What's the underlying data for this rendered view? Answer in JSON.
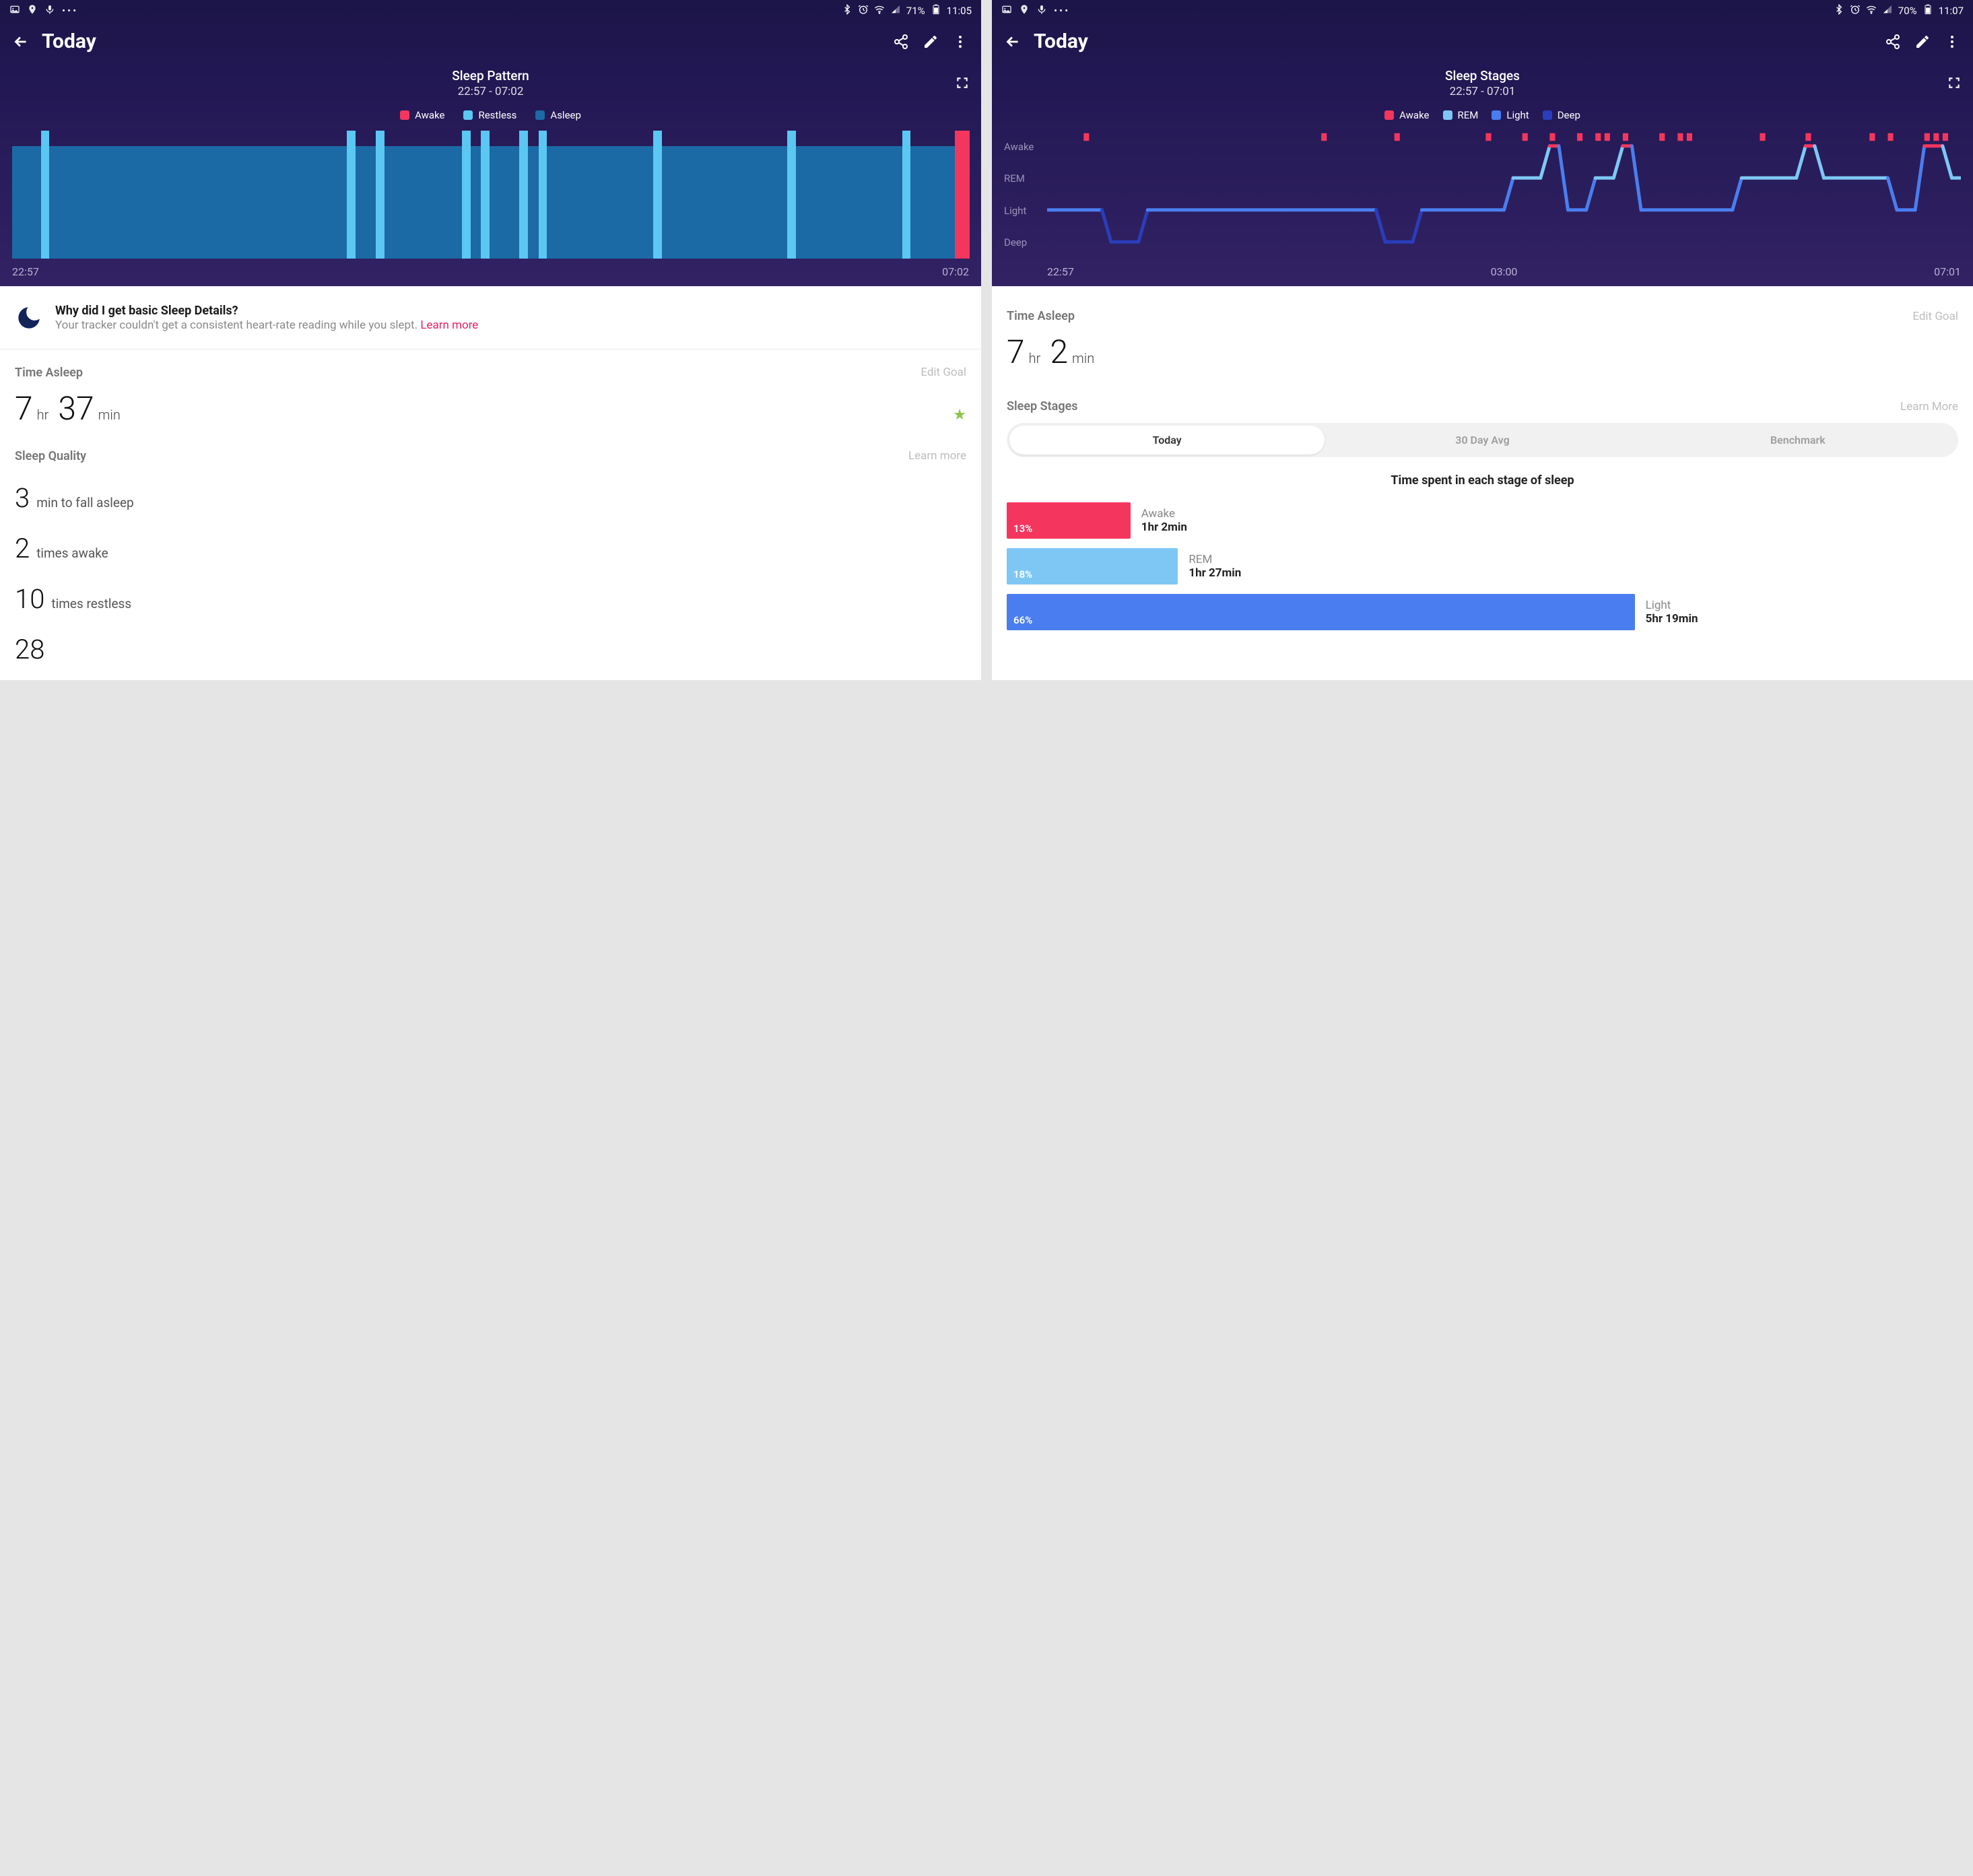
{
  "colors": {
    "awake": "#f4365e",
    "restless": "#5bc7f3",
    "asleep": "#1b6aa5",
    "rem": "#7ec7f5",
    "light": "#4a7ef0",
    "deep": "#2a3dbb",
    "star": "#8bc34a",
    "moon": "#12245a"
  },
  "left": {
    "status": {
      "battery": "71%",
      "time": "11:05"
    },
    "title": "Today",
    "chart": {
      "title": "Sleep Pattern",
      "subtitle": "22:57 - 07:02",
      "legend": [
        "Awake",
        "Restless",
        "Asleep"
      ],
      "xstart": "22:57",
      "xend": "07:02"
    },
    "notice": {
      "title": "Why did I get basic Sleep Details?",
      "body": "Your tracker couldn't get a consistent heart-rate reading while you slept. ",
      "link": "Learn more"
    },
    "time_asleep": {
      "label": "Time Asleep",
      "edit": "Edit Goal",
      "hr": "7",
      "hr_unit": "hr",
      "min": "37",
      "min_unit": "min"
    },
    "quality": {
      "label": "Sleep Quality",
      "link": "Learn more",
      "items": [
        {
          "num": "3",
          "text": "min to fall asleep"
        },
        {
          "num": "2",
          "text": "times awake"
        },
        {
          "num": "10",
          "text": "times restless"
        },
        {
          "num": "28",
          "text": ""
        }
      ]
    }
  },
  "right": {
    "status": {
      "battery": "70%",
      "time": "11:07"
    },
    "title": "Today",
    "chart": {
      "title": "Sleep Stages",
      "subtitle": "22:57 - 07:01",
      "legend": [
        "Awake",
        "REM",
        "Light",
        "Deep"
      ],
      "ylabels": [
        "Awake",
        "REM",
        "Light",
        "Deep"
      ],
      "xstart": "22:57",
      "xmid": "03:00",
      "xend": "07:01"
    },
    "time_asleep": {
      "label": "Time Asleep",
      "edit": "Edit Goal",
      "hr": "7",
      "hr_unit": "hr",
      "min": "2",
      "min_unit": "min"
    },
    "stages": {
      "label": "Sleep Stages",
      "link": "Learn More",
      "tabs": [
        "Today",
        "30 Day Avg",
        "Benchmark"
      ],
      "caption": "Time spent in each stage of sleep",
      "bars": [
        {
          "pct": "13%",
          "name": "Awake",
          "time": "1hr 2min",
          "color": "#f4365e",
          "width": 13
        },
        {
          "pct": "18%",
          "name": "REM",
          "time": "1hr 27min",
          "color": "#7ec7f5",
          "width": 18
        },
        {
          "pct": "66%",
          "name": "Light",
          "time": "5hr 19min",
          "color": "#4a7ef0",
          "width": 66
        }
      ]
    }
  },
  "chart_data": [
    {
      "type": "bar",
      "title": "Sleep Pattern",
      "subtitle": "22:57 - 07:02",
      "categories": [
        "Awake",
        "Restless",
        "Asleep"
      ],
      "x_range": [
        "22:57",
        "07:02"
      ],
      "note": "Stacked timeline of asleep base with restless/awake bars overlaid",
      "events": [
        {
          "type": "restless",
          "at_pct": 3
        },
        {
          "type": "restless",
          "at_pct": 35
        },
        {
          "type": "restless",
          "at_pct": 38
        },
        {
          "type": "restless",
          "at_pct": 47
        },
        {
          "type": "restless",
          "at_pct": 49
        },
        {
          "type": "restless",
          "at_pct": 53
        },
        {
          "type": "restless",
          "at_pct": 55
        },
        {
          "type": "restless",
          "at_pct": 67
        },
        {
          "type": "restless",
          "at_pct": 81
        },
        {
          "type": "restless",
          "at_pct": 93
        },
        {
          "type": "awake",
          "at_pct": 98.5
        }
      ]
    },
    {
      "type": "line",
      "title": "Sleep Stages",
      "subtitle": "22:57 - 07:01",
      "y_categories": [
        "Awake",
        "REM",
        "Light",
        "Deep"
      ],
      "x_range": [
        "22:57",
        "03:00",
        "07:01"
      ],
      "series": [
        {
          "name": "stage",
          "note": "y index 0=Awake top .. 3=Deep bottom; x in percent of width",
          "points": [
            [
              0,
              2
            ],
            [
              6,
              2
            ],
            [
              7,
              3
            ],
            [
              10,
              3
            ],
            [
              11,
              2
            ],
            [
              36,
              2
            ],
            [
              37,
              3
            ],
            [
              40,
              3
            ],
            [
              41,
              2
            ],
            [
              50,
              2
            ],
            [
              51,
              1
            ],
            [
              54,
              1
            ],
            [
              55,
              0
            ],
            [
              56,
              0
            ],
            [
              57,
              2
            ],
            [
              59,
              2
            ],
            [
              60,
              1
            ],
            [
              62,
              1
            ],
            [
              63,
              0
            ],
            [
              64,
              0
            ],
            [
              65,
              2
            ],
            [
              75,
              2
            ],
            [
              76,
              1
            ],
            [
              82,
              1
            ],
            [
              83,
              0
            ],
            [
              84,
              0
            ],
            [
              85,
              1
            ],
            [
              92,
              1
            ],
            [
              93,
              2
            ],
            [
              95,
              2
            ],
            [
              96,
              0
            ],
            [
              98,
              0
            ],
            [
              99,
              1
            ],
            [
              100,
              1
            ]
          ]
        }
      ],
      "awake_ticks_pct": [
        4,
        30,
        38,
        48,
        52,
        55,
        58,
        60,
        61,
        63,
        67,
        69,
        70,
        78,
        83,
        90,
        92,
        96,
        97,
        98
      ]
    }
  ]
}
